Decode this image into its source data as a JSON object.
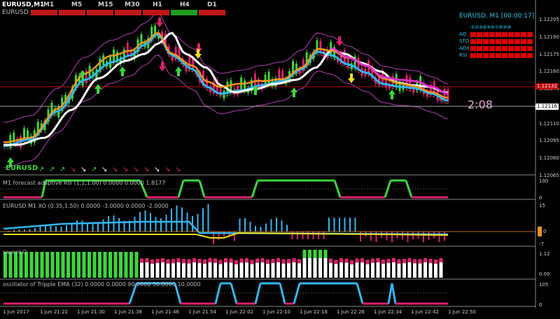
{
  "window": {
    "symbol_title": "EURUSD,M1",
    "symbol_sub": "EURUSD"
  },
  "timeframes": [
    {
      "label": "M1",
      "state": "bear"
    },
    {
      "label": "M5",
      "state": "bear"
    },
    {
      "label": "M15",
      "state": "bear"
    },
    {
      "label": "M30",
      "state": "bear"
    },
    {
      "label": "H1",
      "state": "bear"
    },
    {
      "label": "H4",
      "state": "bull"
    },
    {
      "label": "D1",
      "state": "bear"
    }
  ],
  "info_panel": {
    "title": "EURUSD, M1 [00:00:17]",
    "cycles": "①②③④⑤⑥⑦⑧⑨⑩",
    "rows": [
      {
        "label": "AO",
        "cells": 10
      },
      {
        "label": "STO",
        "cells": 10
      },
      {
        "label": "ADX",
        "cells": 10
      },
      {
        "label": "RSI",
        "cells": 10
      }
    ]
  },
  "countdown": "2:08",
  "main_axis": {
    "ticks": [
      "1.12205",
      "1.12190",
      "1.12175",
      "1.12160",
      "1.12140",
      "1.12125",
      "1.12110",
      "1.12095",
      "1.12080",
      "1.12065"
    ],
    "bid_price": "1.12132",
    "ask_price": "1.12116"
  },
  "panes": {
    "rsi": {
      "label": "M1 forecast adaptive Rsi (1,1,1.00) 0.0000 0.0000 1.8177",
      "ticks": [
        "100",
        "0"
      ]
    },
    "xo": {
      "label": "EURUSD M1 XO (0.35,1.50) 0.0000 -3.0000 0.0000 -2.0000",
      "ticks": [
        "15",
        "0",
        "-7"
      ]
    },
    "laguerre": {
      "label": "sayonLO",
      "ticks": [
        "1.12",
        "0.00"
      ]
    },
    "tema": {
      "label": "oscillator of Tripple EMA (32) 0.0000 0.0000 90.0000 50.0000 10.0000",
      "ticks": [
        "105",
        "0"
      ]
    }
  },
  "signal_row_label": "EURUSD",
  "x_labels": [
    "1 Jun 2017",
    "1 Jun 21:22",
    "1 Jun 21:30",
    "1 Jun 21:38",
    "1 Jun 21:46",
    "1 Jun 21:54",
    "1 Jun 22:02",
    "1 Jun 22:10",
    "1 Jun 22:18",
    "1 Jun 22:26",
    "1 Jun 22:34",
    "1 Jun 22:42",
    "1 Jun 22:50"
  ],
  "colors": {
    "bull": "#3cd63c",
    "bear": "#e0206e",
    "white": "#ffffff",
    "cyan": "#33b6f0",
    "orange": "#f0961e",
    "magenta": "#e030c8",
    "red_line": "#c00000"
  }
}
